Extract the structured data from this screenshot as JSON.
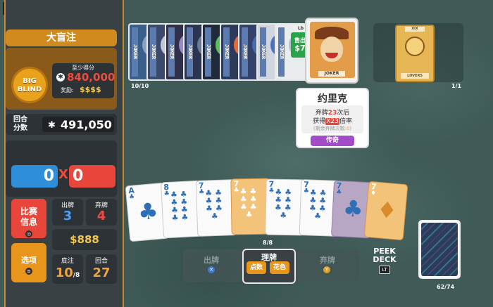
{
  "fps": "40",
  "blind": {
    "title": "大盲注",
    "chip_label": "BIG\nBLIND",
    "score_at_least_label": "至少得分",
    "score_at_least": "840,000",
    "reward_label": "奖励:",
    "reward": "$$$$"
  },
  "round_score": {
    "label": "回合\n分数",
    "value": "491,050"
  },
  "hand": {
    "chips": "0",
    "mult": "0",
    "times": "X"
  },
  "run_info": {
    "label": "比赛\n信息"
  },
  "options": {
    "label": "选项"
  },
  "stats": {
    "hands_label": "出牌",
    "hands": "3",
    "discards_label": "弃牌",
    "discards": "4",
    "money": "$888",
    "ante_label": "底注",
    "ante": "10",
    "ante_total": "/8",
    "round_label": "回合",
    "round": "27"
  },
  "jokers": {
    "count": "10/10",
    "strip_text": "JOKER",
    "price_tag_button": "Lb",
    "price_label": "售出",
    "price": "$7",
    "selected_name_plate": "JOKER"
  },
  "tooltip": {
    "title": "约里克",
    "line1_pre": "弃牌",
    "line1_num": "23",
    "line1_post": "次后",
    "line2_pre": "获得",
    "line2_num": "X23",
    "line2_post": "倍率",
    "line3_pre": "(剩余弃牌次数:",
    "line3_num": "0",
    "line3_post": ")",
    "rarity": "传奇"
  },
  "consumables": {
    "count": "1/1",
    "tarot_top": "XIX",
    "tarot_label": "LOVERS"
  },
  "hand_cards": {
    "count": "8/8",
    "suit": "♣",
    "diamond": "♦",
    "ranks": [
      "A",
      "8",
      "7",
      "7",
      "7",
      "7",
      "7",
      "7"
    ]
  },
  "actions": {
    "play": "出牌",
    "sort_title": "理牌",
    "sort_rank": "点数",
    "sort_suit": "花色",
    "discard": "弃牌"
  },
  "deck": {
    "peek": "PEEK\nDECK",
    "peek_button": "LT",
    "count": "62/74"
  },
  "colors": {
    "chips": "#2f8ed9",
    "mult": "#e8463a",
    "accent": "#d08a1d",
    "legendary": "#a24cc7"
  }
}
